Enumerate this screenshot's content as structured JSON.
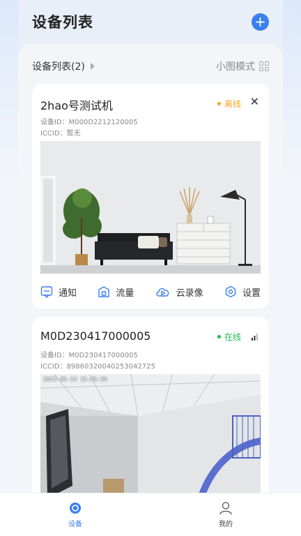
{
  "header": {
    "title": "设备列表",
    "add_label": "+"
  },
  "list_bar": {
    "count_label": "设备列表(2)",
    "mode_label": "小图模式"
  },
  "devices": [
    {
      "name": "2hao号测试机",
      "device_id": "设备ID：M000D2212120005",
      "iccid": "ICCID：暂无",
      "status": "离线",
      "status_color": "#f5a623",
      "close_label": "✕"
    },
    {
      "name": "M0D230417000005",
      "device_id": "设备ID：M0D230417000005",
      "iccid": "ICCID：89860320040253042725",
      "status": "在线",
      "status_color": "#1fb84f",
      "overlay_time": "2023-06-14 15:45:30"
    }
  ],
  "actions": [
    {
      "label": "通知",
      "icon": "notification-icon"
    },
    {
      "label": "流量",
      "icon": "data-usage-icon"
    },
    {
      "label": "云录像",
      "icon": "cloud-video-icon"
    },
    {
      "label": "设置",
      "icon": "settings-icon"
    }
  ],
  "tabs": [
    {
      "label": "设备",
      "icon": "device-tab-icon",
      "active": true
    },
    {
      "label": "我的",
      "icon": "user-icon",
      "active": false
    }
  ],
  "colors": {
    "accent": "#3a7ff0",
    "offline": "#f5a623",
    "online": "#1fb84f"
  }
}
